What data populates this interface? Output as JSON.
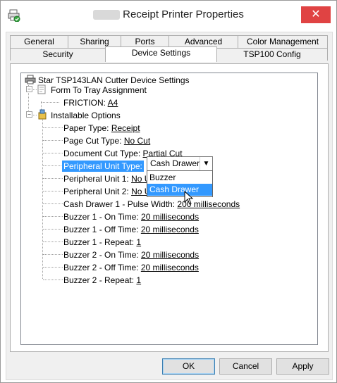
{
  "window": {
    "title": "Receipt Printer Properties",
    "close_symbol": "✕",
    "icon": "printer-icon"
  },
  "tabs": {
    "row1": [
      "General",
      "Sharing",
      "Ports",
      "Advanced",
      "Color Management"
    ],
    "row2": [
      "Security",
      "Device Settings",
      "TSP100 Config"
    ],
    "active": "Device Settings"
  },
  "tree": {
    "root": "Star TSP143LAN Cutter Device Settings",
    "form_to_tray": {
      "label": "Form To Tray Assignment",
      "friction_label": "FRICTION:",
      "friction_value": "A4"
    },
    "installable": {
      "label": "Installable Options",
      "items": [
        {
          "label": "Paper Type:",
          "value": "Receipt"
        },
        {
          "label": "Page Cut Type:",
          "value": "No Cut"
        },
        {
          "label": "Document Cut Type:",
          "value": "Partial Cut"
        },
        {
          "label": "Peripheral Unit Type:",
          "value": ""
        },
        {
          "label": "Peripheral Unit 1:",
          "value": "No U"
        },
        {
          "label": "Peripheral Unit 2:",
          "value": "No U"
        },
        {
          "label": "Cash Drawer 1 - Pulse Width:",
          "value": "200 milliseconds"
        },
        {
          "label": "Buzzer 1 - On Time:",
          "value": "20 milliseconds"
        },
        {
          "label": "Buzzer 1 - Off Time:",
          "value": "20 milliseconds"
        },
        {
          "label": "Buzzer 1 - Repeat:",
          "value": "1"
        },
        {
          "label": "Buzzer 2 - On Time:",
          "value": "20 milliseconds"
        },
        {
          "label": "Buzzer 2 - Off Time:",
          "value": "20 milliseconds"
        },
        {
          "label": "Buzzer 2 - Repeat:",
          "value": "1"
        }
      ]
    }
  },
  "combo": {
    "selected": "Cash Drawer",
    "arrow": "▼",
    "options": [
      "Buzzer",
      "Cash Drawer"
    ],
    "highlighted": "Cash Drawer"
  },
  "buttons": {
    "ok": "OK",
    "cancel": "Cancel",
    "apply": "Apply"
  },
  "colors": {
    "selection": "#3399ff",
    "close": "#e04343"
  }
}
